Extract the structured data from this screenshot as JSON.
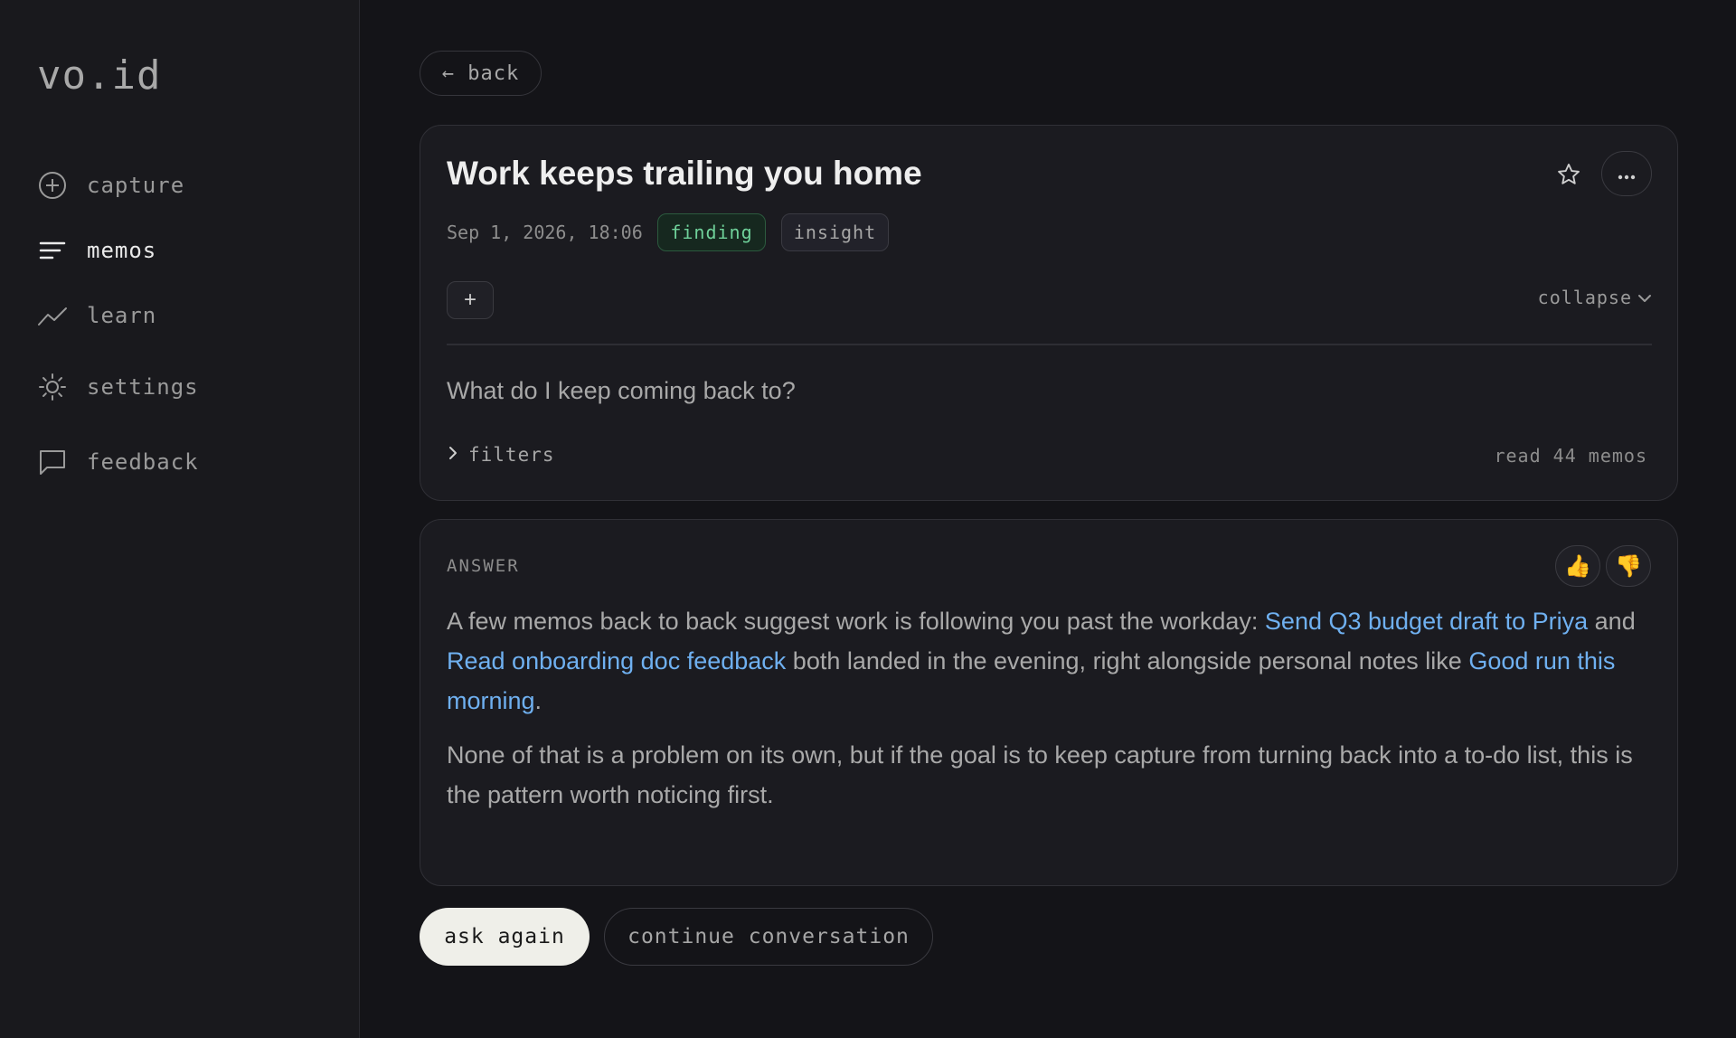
{
  "app": {
    "logo": "vo.id"
  },
  "sidebar": {
    "items": [
      {
        "label": "capture",
        "icon": "plus-circle-icon"
      },
      {
        "label": "memos",
        "icon": "lines-icon",
        "active": true
      },
      {
        "label": "learn",
        "icon": "trend-icon"
      },
      {
        "label": "settings",
        "icon": "sun-gear-icon"
      },
      {
        "label": "feedback",
        "icon": "chat-bubble-icon"
      }
    ]
  },
  "header": {
    "back_label": "← back"
  },
  "memo": {
    "title": "Work keeps trailing you home",
    "date": "Sep 1, 2026, 18:06",
    "tags": [
      "finding",
      "insight"
    ],
    "plus_label": "+",
    "collapse_label": "collapse",
    "question": "What do I keep coming back to?",
    "filters_label": "filters",
    "read_count": "read 44 memos"
  },
  "answer": {
    "label": "ANSWER",
    "thumbs_up": "👍",
    "thumbs_down": "👎",
    "p1_a": "A few memos back to back suggest work is following you past the workday: ",
    "link1": "Send Q3 budget draft to Priya",
    "p1_b": " and ",
    "link2": "Read onboarding doc feedback",
    "p1_c": " both landed in the evening, right alongside personal notes like ",
    "link3": "Good run this morning",
    "p1_d": ".",
    "p2": "None of that is a problem on its own, but if the goal is to keep capture from turning back into a to-do list, this is the pattern worth noticing first."
  },
  "actions": {
    "ask_again": "ask again",
    "continue": "continue conversation"
  },
  "colors": {
    "background": "#141418",
    "sidebar": "#19191d",
    "card": "#1b1b20",
    "link": "#6fb0f0",
    "tag_finding": "#6fd19a"
  }
}
